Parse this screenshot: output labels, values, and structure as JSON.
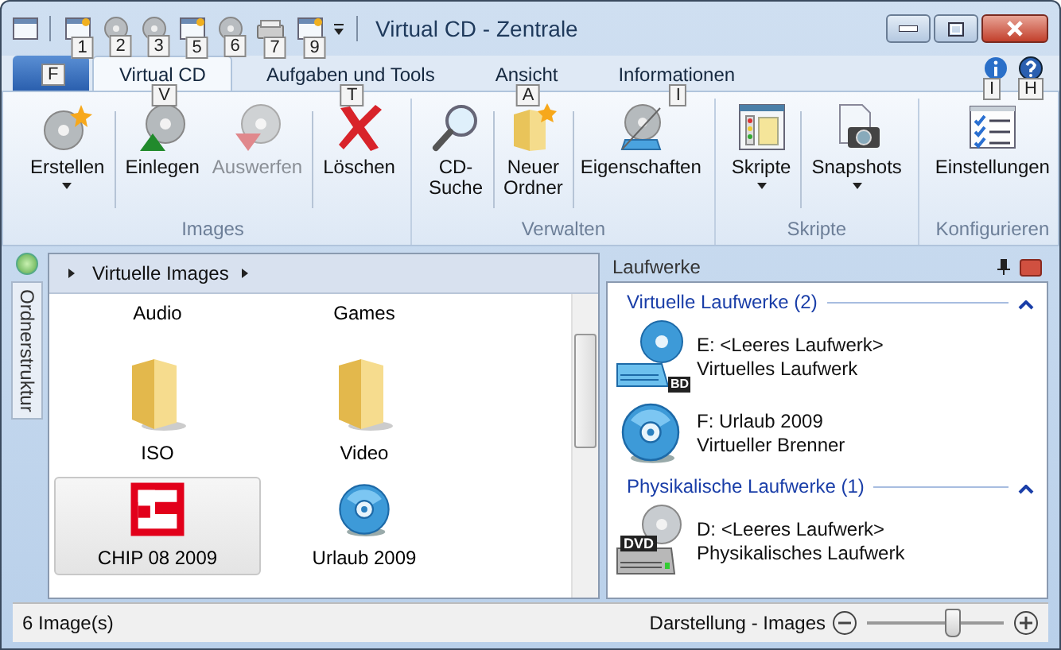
{
  "window": {
    "title": "Virtual CD - Zentrale"
  },
  "quick_access": [
    {
      "kind": "window",
      "keytip": "1"
    },
    {
      "kind": "disc",
      "keytip": "2"
    },
    {
      "kind": "disc",
      "keytip": "3"
    },
    {
      "kind": "window",
      "keytip": "5"
    },
    {
      "kind": "disc",
      "keytip": "6"
    },
    {
      "kind": "drive",
      "keytip": "7"
    },
    {
      "kind": "window",
      "keytip": "9"
    }
  ],
  "app_button": {
    "label": "F"
  },
  "tabs": [
    {
      "label": "Virtual CD",
      "keytip": "V",
      "selected": true
    },
    {
      "label": "Aufgaben und Tools",
      "keytip": "T",
      "selected": false
    },
    {
      "label": "Ansicht",
      "keytip": "A",
      "selected": false
    },
    {
      "label": "Informationen",
      "keytip": "I",
      "selected": false
    }
  ],
  "help_icons": [
    {
      "kind": "info",
      "keytip": "I"
    },
    {
      "kind": "help",
      "keytip": "H"
    }
  ],
  "ribbon_groups": [
    {
      "title": "Images",
      "sets": [
        [
          {
            "label": "Erstellen",
            "kind": "disc-new",
            "dropdown": true,
            "disabled": false
          }
        ],
        [
          {
            "label": "Einlegen",
            "kind": "disc-insert",
            "dropdown": false,
            "disabled": false
          },
          {
            "label": "Auswerfen",
            "kind": "disc-eject",
            "dropdown": false,
            "disabled": true
          }
        ],
        [
          {
            "label": "Löschen",
            "kind": "delete",
            "dropdown": false,
            "disabled": false
          }
        ]
      ]
    },
    {
      "title": "Verwalten",
      "sets": [
        [
          {
            "label": "CD-Suche",
            "kind": "search",
            "dropdown": false,
            "disabled": false
          }
        ],
        [
          {
            "label": "Neuer Ordner",
            "kind": "folder-new",
            "dropdown": false,
            "disabled": false
          }
        ],
        [
          {
            "label": "Eigenschaften",
            "kind": "properties",
            "dropdown": false,
            "disabled": false
          }
        ]
      ]
    },
    {
      "title": "Skripte",
      "sets": [
        [
          {
            "label": "Skripte",
            "kind": "scripts",
            "dropdown": true,
            "disabled": false
          }
        ],
        [
          {
            "label": "Snapshots",
            "kind": "camera",
            "dropdown": true,
            "disabled": false
          }
        ]
      ]
    },
    {
      "title": "Konfigurieren",
      "sets": [
        [
          {
            "label": "Einstellungen",
            "kind": "checklist",
            "dropdown": false,
            "disabled": false
          }
        ]
      ]
    }
  ],
  "side_tab": {
    "label": "Ordnerstruktur"
  },
  "breadcrumb": [
    "Virtuelle Images"
  ],
  "images": [
    {
      "label": "Audio",
      "kind": "none",
      "selected": false
    },
    {
      "label": "Games",
      "kind": "none",
      "selected": false
    },
    {
      "label": "ISO",
      "kind": "folder",
      "selected": false
    },
    {
      "label": "Video",
      "kind": "folder",
      "selected": false
    },
    {
      "label": "CHIP 08 2009",
      "kind": "logo",
      "selected": true
    },
    {
      "label": "Urlaub 2009",
      "kind": "disc",
      "selected": false
    }
  ],
  "drives_panel": {
    "title": "Laufwerke",
    "groups": [
      {
        "title": "Virtuelle Laufwerke (2)",
        "expanded": true,
        "items": [
          {
            "kind": "bd-drive",
            "badge": "BD",
            "name": "E: <Leeres Laufwerk>",
            "type": "Virtuelles Laufwerk"
          },
          {
            "kind": "disc",
            "name": "F: Urlaub 2009",
            "type": "Virtueller Brenner"
          }
        ]
      },
      {
        "title": "Physikalische Laufwerke (1)",
        "expanded": true,
        "items": [
          {
            "kind": "dvd-drive",
            "badge": "DVD",
            "name": "D: <Leeres Laufwerk>",
            "type": "Physikalisches Laufwerk"
          }
        ]
      }
    ]
  },
  "status_bar": {
    "text": "6 Image(s)",
    "zoom_label": "Darstellung - Images",
    "level": 0.63
  }
}
